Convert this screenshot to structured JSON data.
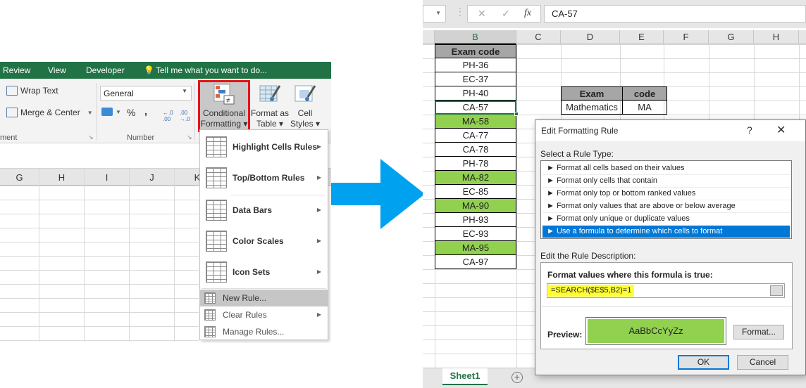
{
  "left": {
    "ribbon_tabs": [
      "Review",
      "View",
      "Developer"
    ],
    "tell_me": "Tell me what you want to do...",
    "alignment": {
      "wrap_text": "Wrap Text",
      "merge_center": "Merge & Center",
      "group_label": "ment"
    },
    "number": {
      "format_value": "General",
      "percent": "%",
      "comma": ",",
      "increase_decimal": "←.0 .00",
      "decrease_decimal": ".00 →.0",
      "group_label": "Number"
    },
    "styles": {
      "conditional_formatting": [
        "Conditional",
        "Formatting ▾"
      ],
      "format_as_table": [
        "Format as",
        "Table ▾"
      ],
      "cell_styles": [
        "Cell",
        "Styles ▾"
      ]
    },
    "column_headers": [
      "G",
      "H",
      "I",
      "J",
      "K"
    ],
    "menu": {
      "items": [
        {
          "label": "Highlight Cells Rules",
          "submenu": true
        },
        {
          "label": "Top/Bottom Rules",
          "submenu": true
        },
        {
          "label": "Data Bars",
          "submenu": true
        },
        {
          "label": "Color Scales",
          "submenu": true
        },
        {
          "label": "Icon Sets",
          "submenu": true
        }
      ],
      "small_items": [
        {
          "label": "New Rule...",
          "submenu": false,
          "highlighted": true
        },
        {
          "label": "Clear Rules",
          "submenu": true,
          "highlighted": false
        },
        {
          "label": "Manage Rules...",
          "submenu": false,
          "highlighted": false
        }
      ]
    }
  },
  "right": {
    "formula_bar": {
      "cancel": "✕",
      "enter": "✓",
      "fx": "fx",
      "value": "CA-57"
    },
    "column_headers": [
      "B",
      "C",
      "D",
      "E",
      "F",
      "G",
      "H"
    ],
    "selected_column": "B",
    "exam_code_header": "Exam code",
    "exam_codes": [
      {
        "value": "PH-36",
        "highlighted": false
      },
      {
        "value": "EC-37",
        "highlighted": false
      },
      {
        "value": "PH-40",
        "highlighted": false
      },
      {
        "value": "CA-57",
        "highlighted": false,
        "active": true
      },
      {
        "value": "MA-58",
        "highlighted": true
      },
      {
        "value": "CA-77",
        "highlighted": false
      },
      {
        "value": "CA-78",
        "highlighted": false
      },
      {
        "value": "PH-78",
        "highlighted": false
      },
      {
        "value": "MA-82",
        "highlighted": true
      },
      {
        "value": "EC-85",
        "highlighted": false
      },
      {
        "value": "MA-90",
        "highlighted": true
      },
      {
        "value": "PH-93",
        "highlighted": false
      },
      {
        "value": "EC-93",
        "highlighted": false
      },
      {
        "value": "MA-95",
        "highlighted": true
      },
      {
        "value": "CA-97",
        "highlighted": false
      }
    ],
    "lookup_table": {
      "headers": [
        "Exam",
        "code"
      ],
      "row": [
        "Mathematics",
        "MA"
      ]
    },
    "sheet_tab": "Sheet1",
    "add_sheet": "+",
    "colors": {
      "highlight_green": "#92d050",
      "excel_green": "#217346",
      "selection_blue": "#0078d7",
      "formula_highlight": "#ffff33"
    }
  },
  "dialog": {
    "title": "Edit Formatting Rule",
    "help": "?",
    "close": "✕",
    "select_rule_type_label": "Select a Rule Type:",
    "rule_types": [
      {
        "label": "► Format all cells based on their values",
        "selected": false
      },
      {
        "label": "► Format only cells that contain",
        "selected": false
      },
      {
        "label": "► Format only top or bottom ranked values",
        "selected": false
      },
      {
        "label": "► Format only values that are above or below average",
        "selected": false
      },
      {
        "label": "► Format only unique or duplicate values",
        "selected": false
      },
      {
        "label": "► Use a formula to determine which cells to format",
        "selected": true
      }
    ],
    "edit_description_label": "Edit the Rule Description:",
    "formula_label": "Format values where this formula is true:",
    "formula_value": "=SEARCH($E$5,B2)=1",
    "preview_label": "Preview:",
    "preview_text": "AaBbCcYyZz",
    "format_button": "Format...",
    "ok_button": "OK",
    "cancel_button": "Cancel"
  }
}
